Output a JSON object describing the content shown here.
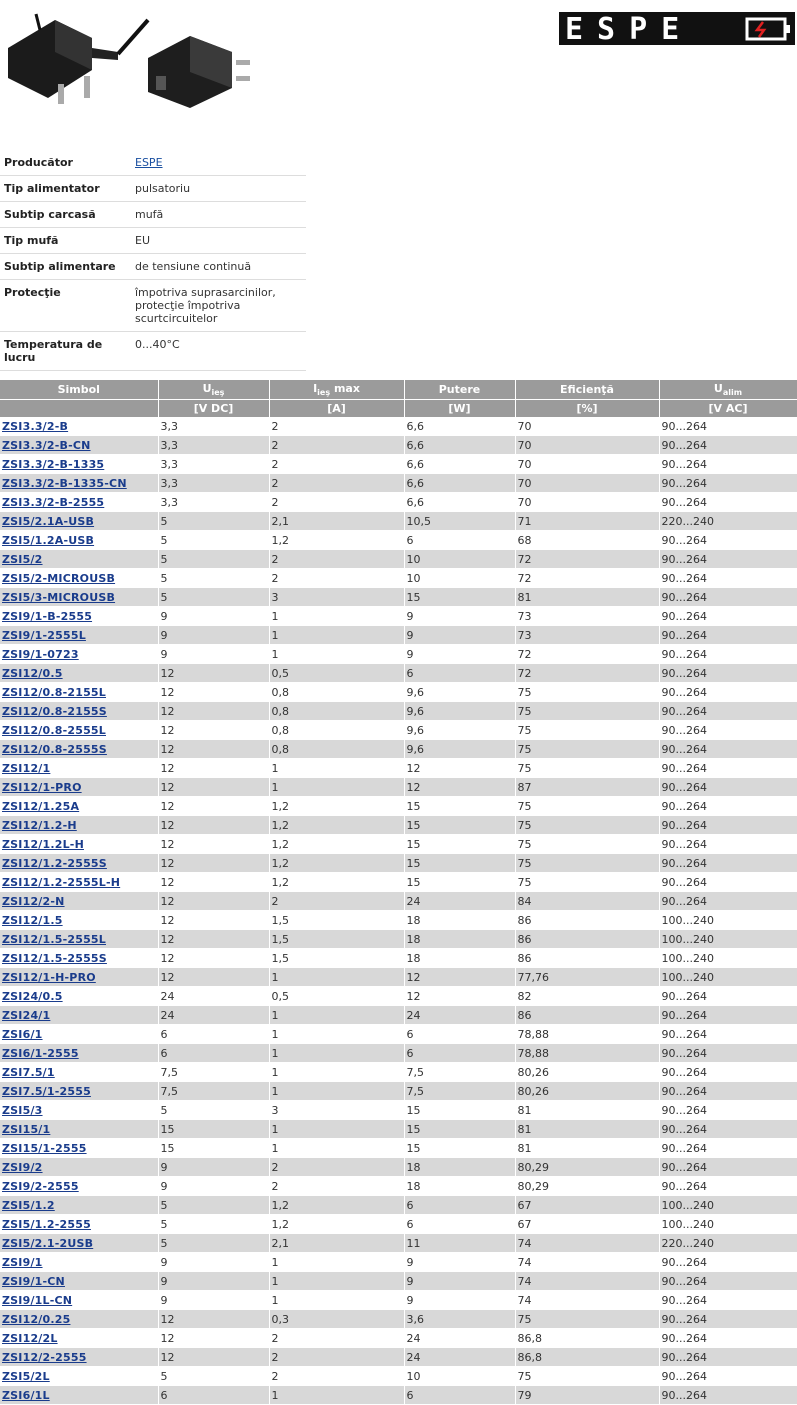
{
  "brand": {
    "logo_text": "ESPE"
  },
  "specs": [
    {
      "label": "Producător",
      "value": "ESPE",
      "link": true
    },
    {
      "label": "Tip alimentator",
      "value": "pulsatoriu"
    },
    {
      "label": "Subtip carcasă",
      "value": "mufă"
    },
    {
      "label": "Tip mufă",
      "value": "EU"
    },
    {
      "label": "Subtip alimentare",
      "value": "de tensiune continuă"
    },
    {
      "label": "Protecţie",
      "value": "împotriva suprasarcinilor,\nprotecţie împotriva scurtcircuitelor"
    },
    {
      "label": "Temperatura de lucru",
      "value": "0...40°C"
    }
  ],
  "table": {
    "headers": {
      "symbol": "Simbol",
      "u_out": "U",
      "u_out_sub": "ieş",
      "i_out": "I",
      "i_out_sub": "ieş",
      "i_out_suffix": " max",
      "power": "Putere",
      "efficiency": "Eficienţă",
      "u_in": "U",
      "u_in_sub": "alim"
    },
    "units": [
      "",
      "[V DC]",
      "[A]",
      "[W]",
      "[%]",
      "[V AC]"
    ],
    "rows": [
      [
        "ZSI3.3/2-B",
        "3,3",
        "2",
        "6,6",
        "70",
        "90...264"
      ],
      [
        "ZSI3.3/2-B-CN",
        "3,3",
        "2",
        "6,6",
        "70",
        "90...264"
      ],
      [
        "ZSI3.3/2-B-1335",
        "3,3",
        "2",
        "6,6",
        "70",
        "90...264"
      ],
      [
        "ZSI3.3/2-B-1335-CN",
        "3,3",
        "2",
        "6,6",
        "70",
        "90...264"
      ],
      [
        "ZSI3.3/2-B-2555",
        "3,3",
        "2",
        "6,6",
        "70",
        "90...264"
      ],
      [
        "ZSI5/2.1A-USB",
        "5",
        "2,1",
        "10,5",
        "71",
        "220...240"
      ],
      [
        "ZSI5/1.2A-USB",
        "5",
        "1,2",
        "6",
        "68",
        "90...264"
      ],
      [
        "ZSI5/2",
        "5",
        "2",
        "10",
        "72",
        "90...264"
      ],
      [
        "ZSI5/2-MICROUSB",
        "5",
        "2",
        "10",
        "72",
        "90...264"
      ],
      [
        "ZSI5/3-MICROUSB",
        "5",
        "3",
        "15",
        "81",
        "90...264"
      ],
      [
        "ZSI9/1-B-2555",
        "9",
        "1",
        "9",
        "73",
        "90...264"
      ],
      [
        "ZSI9/1-2555L",
        "9",
        "1",
        "9",
        "73",
        "90...264"
      ],
      [
        "ZSI9/1-0723",
        "9",
        "1",
        "9",
        "72",
        "90...264"
      ],
      [
        "ZSI12/0.5",
        "12",
        "0,5",
        "6",
        "72",
        "90...264"
      ],
      [
        "ZSI12/0.8-2155L",
        "12",
        "0,8",
        "9,6",
        "75",
        "90...264"
      ],
      [
        "ZSI12/0.8-2155S",
        "12",
        "0,8",
        "9,6",
        "75",
        "90...264"
      ],
      [
        "ZSI12/0.8-2555L",
        "12",
        "0,8",
        "9,6",
        "75",
        "90...264"
      ],
      [
        "ZSI12/0.8-2555S",
        "12",
        "0,8",
        "9,6",
        "75",
        "90...264"
      ],
      [
        "ZSI12/1",
        "12",
        "1",
        "12",
        "75",
        "90...264"
      ],
      [
        "ZSI12/1-PRO",
        "12",
        "1",
        "12",
        "87",
        "90...264"
      ],
      [
        "ZSI12/1.25A",
        "12",
        "1,2",
        "15",
        "75",
        "90...264"
      ],
      [
        "ZSI12/1.2-H",
        "12",
        "1,2",
        "15",
        "75",
        "90...264"
      ],
      [
        "ZSI12/1.2L-H",
        "12",
        "1,2",
        "15",
        "75",
        "90...264"
      ],
      [
        "ZSI12/1.2-2555S",
        "12",
        "1,2",
        "15",
        "75",
        "90...264"
      ],
      [
        "ZSI12/1.2-2555L-H",
        "12",
        "1,2",
        "15",
        "75",
        "90...264"
      ],
      [
        "ZSI12/2-N",
        "12",
        "2",
        "24",
        "84",
        "90...264"
      ],
      [
        "ZSI12/1.5",
        "12",
        "1,5",
        "18",
        "86",
        "100...240"
      ],
      [
        "ZSI12/1.5-2555L",
        "12",
        "1,5",
        "18",
        "86",
        "100...240"
      ],
      [
        "ZSI12/1.5-2555S",
        "12",
        "1,5",
        "18",
        "86",
        "100...240"
      ],
      [
        "ZSI12/1-H-PRO",
        "12",
        "1",
        "12",
        "77,76",
        "100...240"
      ],
      [
        "ZSI24/0.5",
        "24",
        "0,5",
        "12",
        "82",
        "90...264"
      ],
      [
        "ZSI24/1",
        "24",
        "1",
        "24",
        "86",
        "90...264"
      ],
      [
        "ZSI6/1",
        "6",
        "1",
        "6",
        "78,88",
        "90...264"
      ],
      [
        "ZSI6/1-2555",
        "6",
        "1",
        "6",
        "78,88",
        "90...264"
      ],
      [
        "ZSI7.5/1",
        "7,5",
        "1",
        "7,5",
        "80,26",
        "90...264"
      ],
      [
        "ZSI7.5/1-2555",
        "7,5",
        "1",
        "7,5",
        "80,26",
        "90...264"
      ],
      [
        "ZSI5/3",
        "5",
        "3",
        "15",
        "81",
        "90...264"
      ],
      [
        "ZSI15/1",
        "15",
        "1",
        "15",
        "81",
        "90...264"
      ],
      [
        "ZSI15/1-2555",
        "15",
        "1",
        "15",
        "81",
        "90...264"
      ],
      [
        "ZSI9/2",
        "9",
        "2",
        "18",
        "80,29",
        "90...264"
      ],
      [
        "ZSI9/2-2555",
        "9",
        "2",
        "18",
        "80,29",
        "90...264"
      ],
      [
        "ZSI5/1.2",
        "5",
        "1,2",
        "6",
        "67",
        "100...240"
      ],
      [
        "ZSI5/1.2-2555",
        "5",
        "1,2",
        "6",
        "67",
        "100...240"
      ],
      [
        "ZSI5/2.1-2USB",
        "5",
        "2,1",
        "11",
        "74",
        "220...240"
      ],
      [
        "ZSI9/1",
        "9",
        "1",
        "9",
        "74",
        "90...264"
      ],
      [
        "ZSI9/1-CN",
        "9",
        "1",
        "9",
        "74",
        "90...264"
      ],
      [
        "ZSI9/1L-CN",
        "9",
        "1",
        "9",
        "74",
        "90...264"
      ],
      [
        "ZSI12/0.25",
        "12",
        "0,3",
        "3,6",
        "75",
        "90...264"
      ],
      [
        "ZSI12/2L",
        "12",
        "2",
        "24",
        "86,8",
        "90...264"
      ],
      [
        "ZSI12/2-2555",
        "12",
        "2",
        "24",
        "86,8",
        "90...264"
      ],
      [
        "ZSI5/2L",
        "5",
        "2",
        "10",
        "75",
        "90...264"
      ],
      [
        "ZSI6/1L",
        "6",
        "1",
        "6",
        "79",
        "90...264"
      ]
    ]
  }
}
